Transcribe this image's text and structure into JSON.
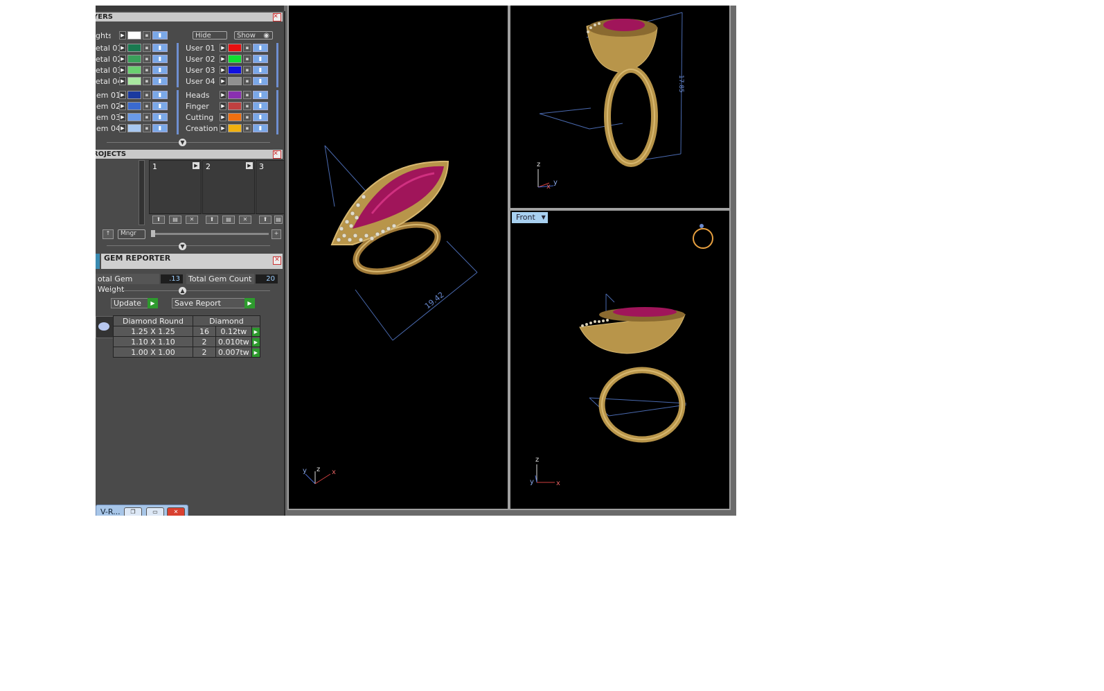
{
  "layers": {
    "title": "YERS",
    "lights_label": "ghts",
    "hide_label": "Hide",
    "show_label": "Show",
    "left_group1": [
      {
        "name": "etal 01",
        "color": "#1a7a50"
      },
      {
        "name": "etal 02",
        "color": "#3aa05a"
      },
      {
        "name": "etal 03",
        "color": "#6ad070"
      },
      {
        "name": "etal 04",
        "color": "#a8e8a0"
      }
    ],
    "right_group1": [
      {
        "name": "User 01",
        "color": "#e81010"
      },
      {
        "name": "User 02",
        "color": "#10e030"
      },
      {
        "name": "User 03",
        "color": "#1010e0"
      },
      {
        "name": "User 04",
        "color": "#909090"
      }
    ],
    "left_group2": [
      {
        "name": "em 01",
        "color": "#1a3aa0"
      },
      {
        "name": "em 02",
        "color": "#3a6ad0"
      },
      {
        "name": "em 03",
        "color": "#6a9ae8"
      },
      {
        "name": "em 04",
        "color": "#a8c8f0"
      }
    ],
    "right_group2": [
      {
        "name": "Heads",
        "color": "#8a30b0"
      },
      {
        "name": "Finger",
        "color": "#c04040"
      },
      {
        "name": "Cutting",
        "color": "#f07010"
      },
      {
        "name": "Creation",
        "color": "#f0b010"
      }
    ]
  },
  "projects": {
    "title": "ROJECTS",
    "slots": [
      "1",
      "2",
      "3"
    ],
    "manager_label": "Mngr"
  },
  "gem_reporter": {
    "title": "GEM REPORTER",
    "weight_label": "otal Gem Weight",
    "weight_value": ".13",
    "count_label": "Total Gem Count",
    "count_value": "20",
    "update_label": "Update",
    "save_label": "Save Report",
    "table_headers": [
      "Diamond Round",
      "Diamond"
    ],
    "rows": [
      {
        "size": "1.25 X 1.25",
        "count": "16",
        "weight": "0.12tw"
      },
      {
        "size": "1.10 X 1.10",
        "count": "2",
        "weight": "0.010tw"
      },
      {
        "size": "1.00 X 1.00",
        "count": "2",
        "weight": "0.007tw"
      }
    ]
  },
  "taskbar": {
    "title": "V-R..."
  },
  "viewports": {
    "perspective": {
      "dimension": "19.42",
      "axes": [
        "y",
        "z",
        "x"
      ]
    },
    "side": {
      "dimension": "17.85",
      "axes": [
        "z",
        "x",
        "y"
      ]
    },
    "front": {
      "view_label": "Front",
      "axes": [
        "z",
        "y",
        "x"
      ]
    }
  },
  "colors": {
    "gold": "#b8954a",
    "gem": "#a0155a",
    "selection_blue": "#a8d0f0"
  }
}
